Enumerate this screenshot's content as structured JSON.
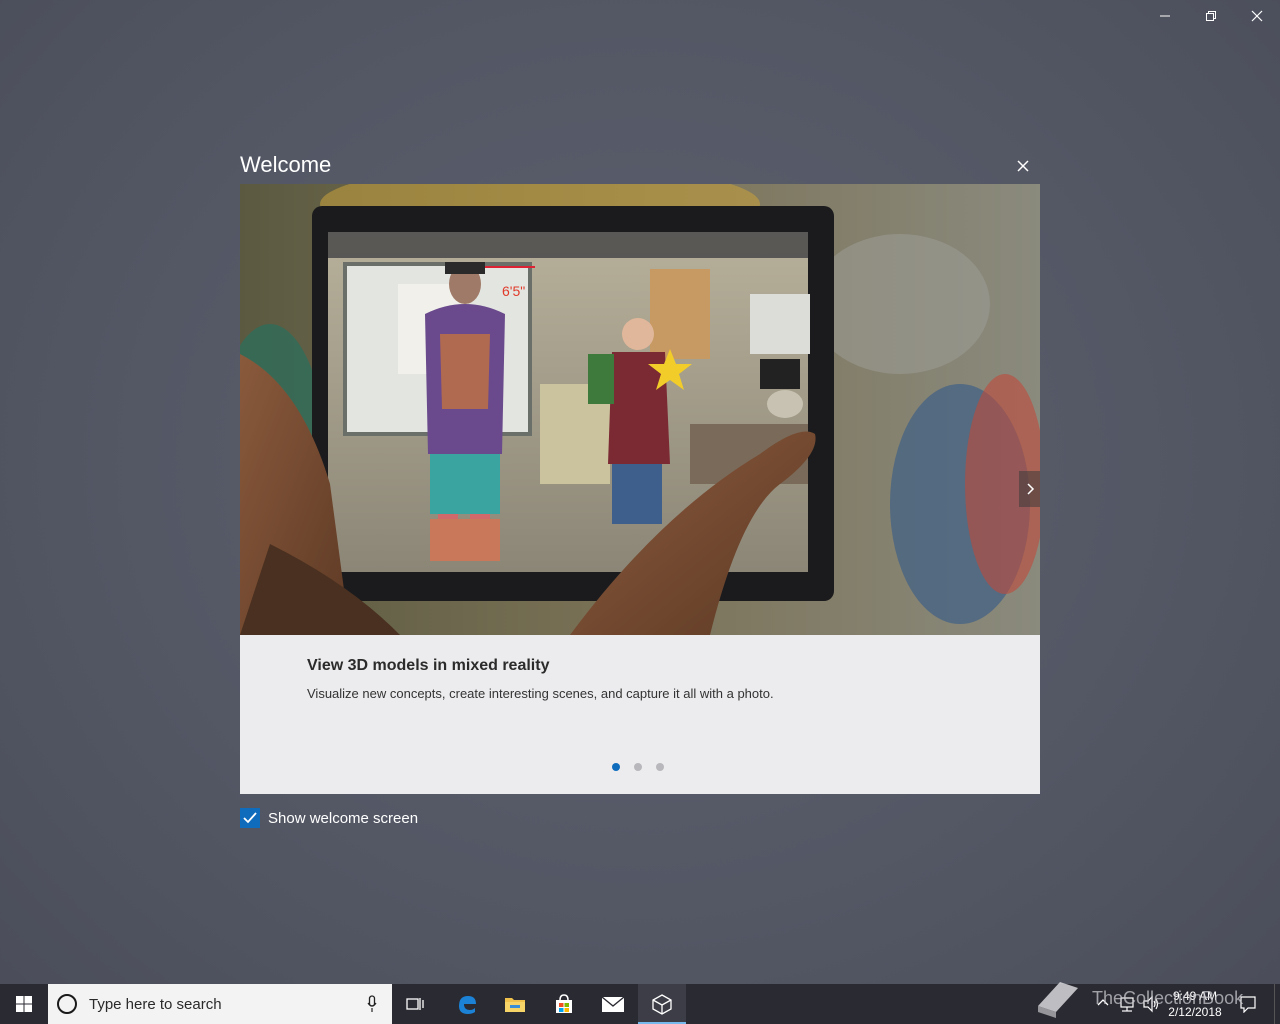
{
  "window": {
    "minimize_icon": "minimize-icon",
    "restore_icon": "restore-icon",
    "close_icon": "close-icon"
  },
  "dialog": {
    "title": "Welcome",
    "close_icon": "close-icon",
    "slide": {
      "title": "View 3D models in mixed reality",
      "description": "Visualize new concepts, create interesting scenes, and capture it all with a photo.",
      "overlay_measure": "6'5\""
    },
    "pager": {
      "count": 3,
      "active": 0
    },
    "next_icon": "chevron-right-icon",
    "show_welcome": {
      "label": "Show welcome screen",
      "checked": true
    }
  },
  "taskbar": {
    "search_placeholder": "Type here to search",
    "apps": [
      "task-view",
      "microsoft-edge",
      "file-explorer",
      "microsoft-store",
      "mail",
      "3d-viewer"
    ],
    "clock": {
      "time": "9:49 AM",
      "date": "2/12/2018"
    },
    "watermark": "TheCollectionBook"
  },
  "colors": {
    "accent": "#0f6cbd",
    "taskbar": "#2a2a33",
    "background": "#545865"
  }
}
